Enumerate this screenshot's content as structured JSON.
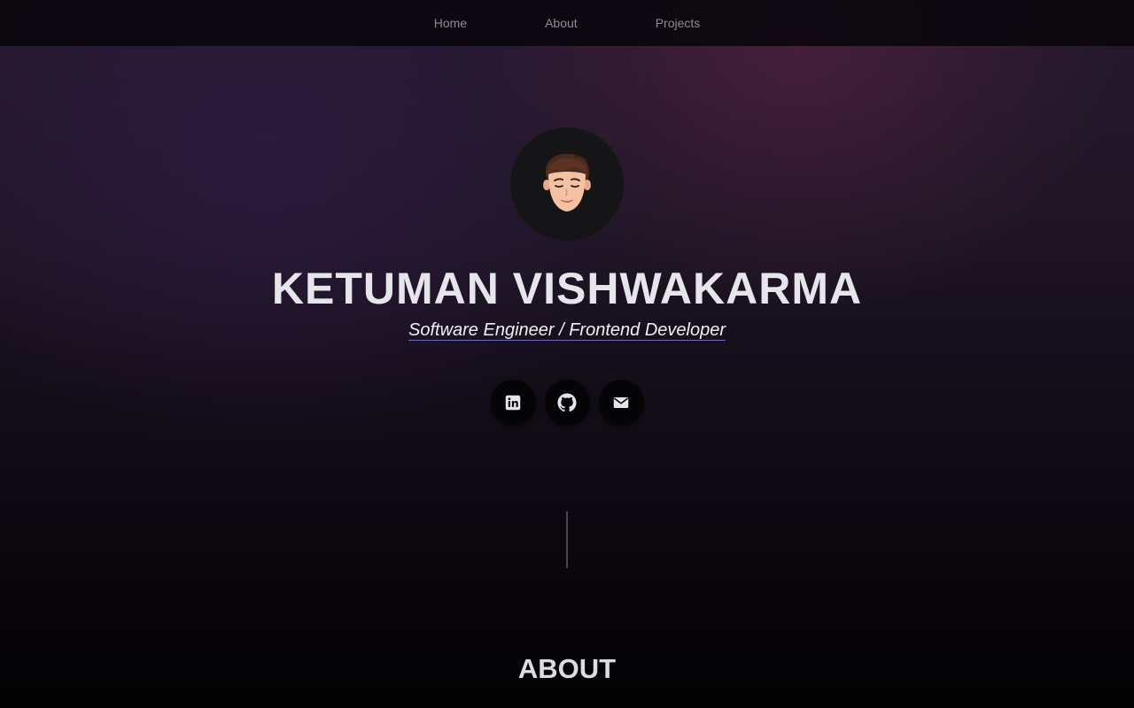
{
  "nav": {
    "items": [
      {
        "label": "Home"
      },
      {
        "label": "About"
      },
      {
        "label": "Projects"
      }
    ]
  },
  "hero": {
    "name": "KETUMAN VISHWAKARMA",
    "tagline": "Software Engineer / Frontend Developer",
    "avatar_icon": "cartoon-avatar-icon",
    "socials": [
      {
        "name": "LinkedIn",
        "icon": "linkedin-icon"
      },
      {
        "name": "GitHub",
        "icon": "github-icon"
      },
      {
        "name": "Email",
        "icon": "mail-icon"
      }
    ]
  },
  "about": {
    "title": "ABOUT"
  },
  "colors": {
    "tagline_underline": "#7068c8",
    "background_top": "#251a2d",
    "background_bottom": "#030203"
  }
}
